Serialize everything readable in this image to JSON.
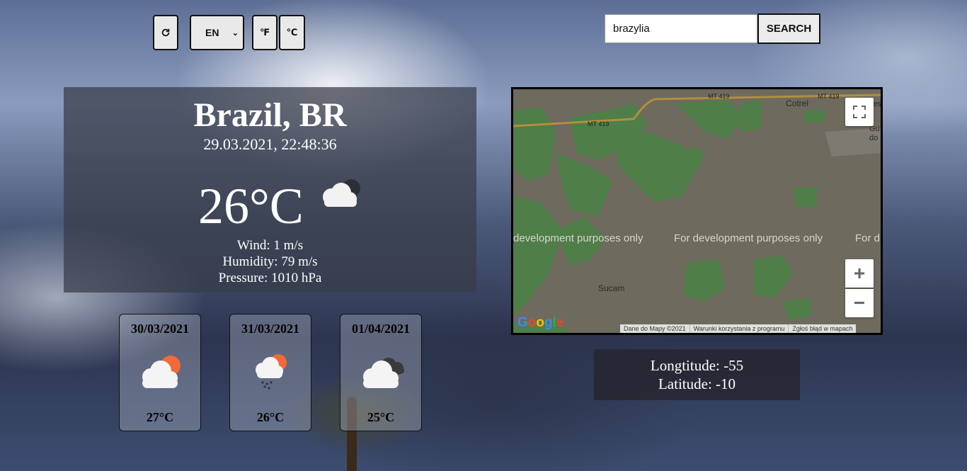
{
  "toolbar": {
    "refresh_icon": "refresh-icon",
    "language": "EN",
    "unit_f": "℉",
    "unit_c": "℃"
  },
  "search": {
    "value": "brazylia",
    "button_label": "SEARCH"
  },
  "current": {
    "city": "Brazil, BR",
    "datetime": "29.03.2021, 22:48:36",
    "temperature": "26°C",
    "icon": "cloudy-night-icon",
    "wind": "Wind: 1 m/s",
    "humidity": "Humidity: 79 m/s",
    "pressure": "Pressure: 1010 hPa"
  },
  "forecast": [
    {
      "date": "30/03/2021",
      "temp": "27°C",
      "icon": "partly-cloudy-sun-icon"
    },
    {
      "date": "31/03/2021",
      "temp": "26°C",
      "icon": "rain-sun-icon"
    },
    {
      "date": "01/04/2021",
      "temp": "25°C",
      "icon": "dark-clouds-icon"
    }
  ],
  "map": {
    "road_label_1": "MT 419",
    "road_label_2": "MT 419",
    "road_label_3": "MT 419",
    "place_cotrel": "Cotrel",
    "place_sucam": "Sucam",
    "place_gu": "Gu",
    "place_do": "do",
    "place_es": "es",
    "dev_text_1": "development purposes only",
    "dev_text_2": "For development purposes only",
    "dev_text_3": "For d",
    "zoom_in": "+",
    "zoom_out": "−",
    "logo": "Google",
    "footer_data": "Dane do Mapy ©2021",
    "footer_terms": "Warunki korzystania z programu",
    "footer_report": "Zgłoś błąd w mapach"
  },
  "coordinates": {
    "longitude": "Longtitude: -55",
    "latitude": "Latitude: -10"
  }
}
